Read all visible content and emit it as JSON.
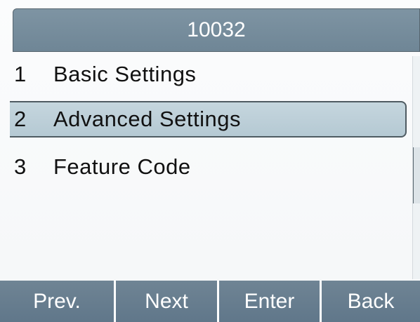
{
  "title": "10032",
  "menu": {
    "items": [
      {
        "num": "1",
        "label": "Basic  Settings"
      },
      {
        "num": "2",
        "label": "Advanced  Settings"
      },
      {
        "num": "3",
        "label": "Feature  Code"
      }
    ],
    "selected_index": 1
  },
  "softkeys": [
    "Prev.",
    "Next",
    "Enter",
    "Back"
  ],
  "colors": {
    "titlebar": "#7688a0",
    "selection": "#bccfd8",
    "softkey": "#687e91"
  }
}
